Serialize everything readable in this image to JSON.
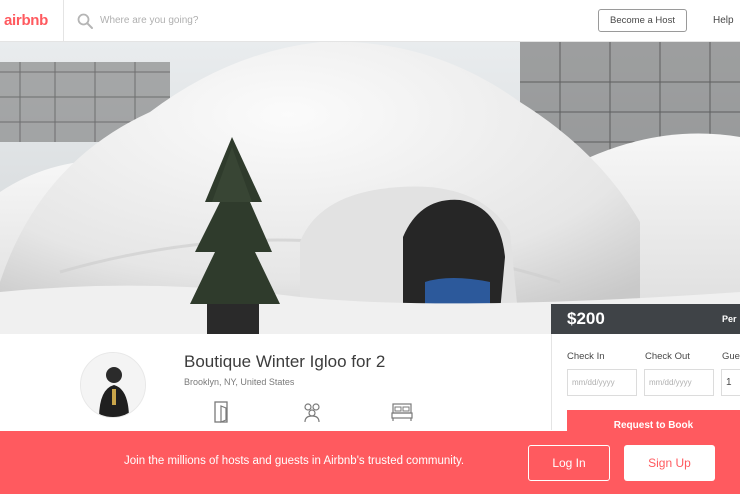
{
  "header": {
    "logo_text": "airbnb",
    "search_placeholder": "Where are you going?",
    "become_host_label": "Become a Host",
    "help_label": "Help"
  },
  "listing": {
    "title": "Boutique Winter Igloo for 2",
    "location": "Brooklyn, NY, United States"
  },
  "booking": {
    "price": "$200",
    "per_label": "Per",
    "check_in_label": "Check In",
    "check_out_label": "Check Out",
    "guests_label": "Gue",
    "check_in_placeholder": "mm/dd/yyyy",
    "check_out_placeholder": "mm/dd/yyyy",
    "guests_value": "1",
    "request_button": "Request to Book"
  },
  "banner": {
    "message": "Join the millions of hosts and guests in Airbnb's trusted community.",
    "login_label": "Log In",
    "signup_label": "Sign Up"
  },
  "colors": {
    "brand": "#ff5a5f",
    "price_bar": "#3f4347"
  },
  "icons": [
    "search-icon",
    "door-icon",
    "guests-icon",
    "bed-icon"
  ]
}
